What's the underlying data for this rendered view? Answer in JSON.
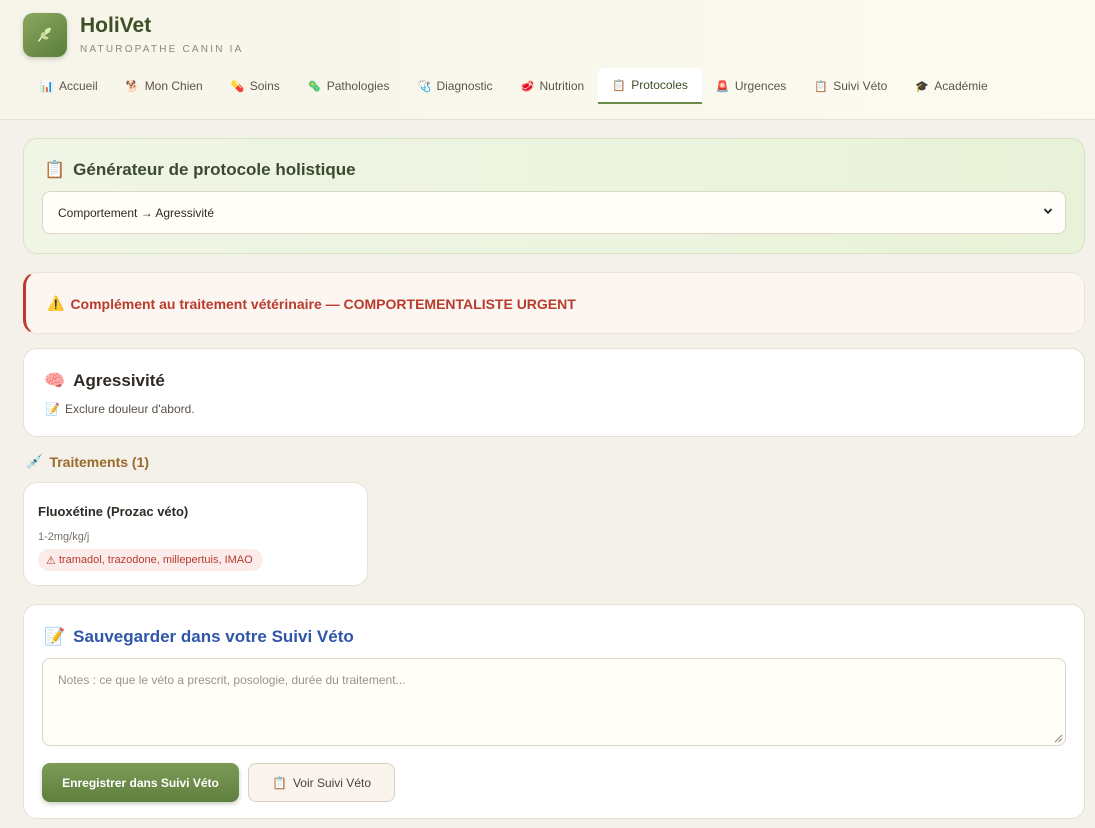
{
  "app": {
    "title": "HoliVet",
    "subtitle": "NATUROPATHE CANIN IA",
    "logo_icon": "leaf-icon"
  },
  "nav": {
    "items": [
      {
        "label": "Accueil",
        "icon": "📊"
      },
      {
        "label": "Mon Chien",
        "icon": "🐕"
      },
      {
        "label": "Soins",
        "icon": "💊"
      },
      {
        "label": "Pathologies",
        "icon": "🦠"
      },
      {
        "label": "Diagnostic",
        "icon": "🩺"
      },
      {
        "label": "Nutrition",
        "icon": "🥩"
      },
      {
        "label": "Protocoles",
        "icon": "📋",
        "active": true
      },
      {
        "label": "Urgences",
        "icon": "🚨"
      },
      {
        "label": "Suivi Véto",
        "icon": "📋"
      },
      {
        "label": "Académie",
        "icon": "🎓"
      }
    ]
  },
  "generator": {
    "icon": "📋",
    "title": "Générateur de protocole holistique",
    "selected": "Comportement → Agressivité"
  },
  "warning": {
    "icon": "⚠️",
    "text": "Complément au traitement vétérinaire — COMPORTEMENTALISTE URGENT",
    "color": "#b83b2c"
  },
  "pathology": {
    "icon": "🧠",
    "title": "Agressivité",
    "note_icon": "📝",
    "note": "Exclure douleur d'abord."
  },
  "treatments": {
    "icon": "💉",
    "title": "Traitements (1)",
    "items": [
      {
        "name": "Fluoxétine (Prozac véto)",
        "dose": "1-2mg/kg/j",
        "warning_icon": "⚠",
        "interactions": "tramadol, trazodone, millepertuis, IMAO"
      }
    ]
  },
  "save": {
    "icon": "📝",
    "title": "Sauvegarder dans votre Suivi Véto",
    "notes_placeholder": "Notes : ce que le véto a prescrit, posologie, durée du traitement...",
    "save_label": "Enregistrer dans Suivi Véto",
    "view_icon": "📋",
    "view_label": "Voir Suivi Véto"
  },
  "colors": {
    "accent": "#6b8a48",
    "danger": "#b83b2c",
    "link": "#2f56a8"
  }
}
